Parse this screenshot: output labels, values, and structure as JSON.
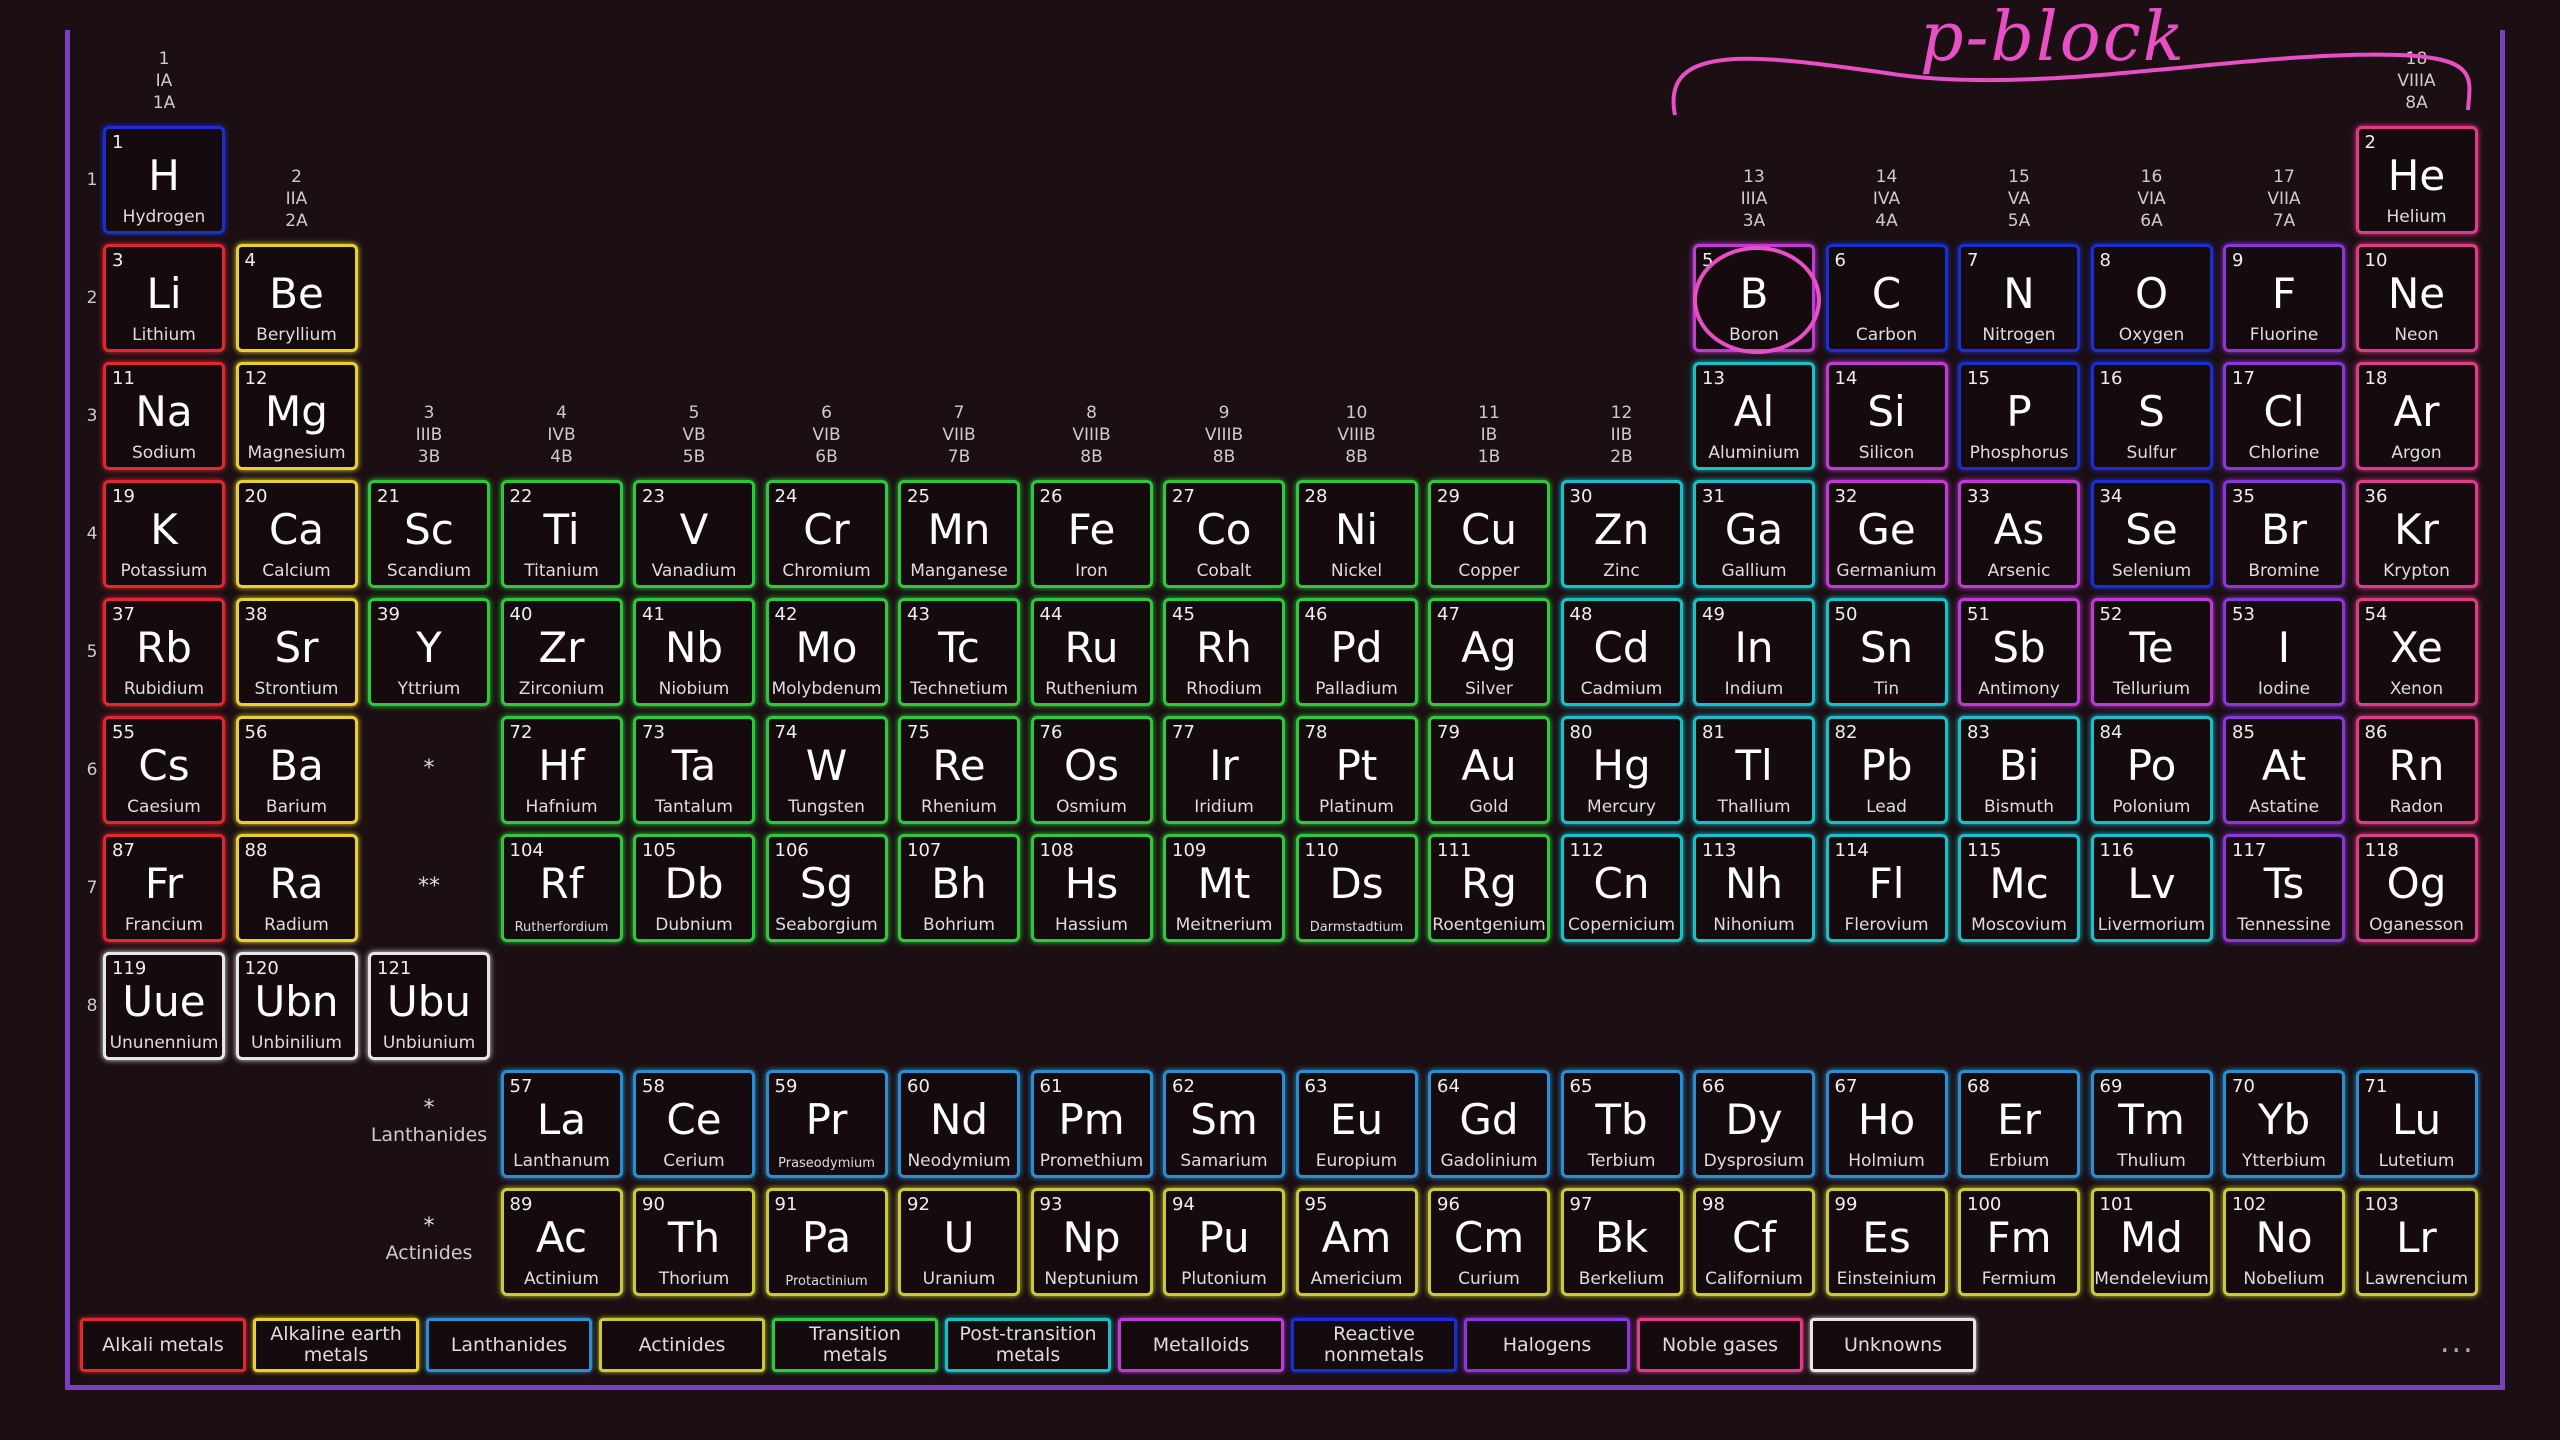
{
  "annotation": {
    "text": "p-block",
    "color": "#e94fc4"
  },
  "categories": {
    "alkali": "#e02830",
    "alkaline": "#e8d030",
    "lanthanide": "#2a8fd0",
    "actinide": "#c9c93a",
    "transition": "#2dc83c",
    "post": "#19c0c8",
    "metalloid": "#c03ad8",
    "nonmetal": "#1c2ecf",
    "halogen": "#8a36d8",
    "noble": "#e03a8a",
    "unknown": "#e6e6e6"
  },
  "elements": [
    [
      "1",
      "H",
      "Hydrogen",
      "nonmetal"
    ],
    [
      "2",
      "He",
      "Helium",
      "noble"
    ],
    [
      "3",
      "Li",
      "Lithium",
      "alkali"
    ],
    [
      "4",
      "Be",
      "Beryllium",
      "alkaline"
    ],
    [
      "5",
      "B",
      "Boron",
      "metalloid"
    ],
    [
      "6",
      "C",
      "Carbon",
      "nonmetal"
    ],
    [
      "7",
      "N",
      "Nitrogen",
      "nonmetal"
    ],
    [
      "8",
      "O",
      "Oxygen",
      "nonmetal"
    ],
    [
      "9",
      "F",
      "Fluorine",
      "halogen"
    ],
    [
      "10",
      "Ne",
      "Neon",
      "noble"
    ],
    [
      "11",
      "Na",
      "Sodium",
      "alkali"
    ],
    [
      "12",
      "Mg",
      "Magnesium",
      "alkaline"
    ],
    [
      "13",
      "Al",
      "Aluminium",
      "post"
    ],
    [
      "14",
      "Si",
      "Silicon",
      "metalloid"
    ],
    [
      "15",
      "P",
      "Phosphorus",
      "nonmetal"
    ],
    [
      "16",
      "S",
      "Sulfur",
      "nonmetal"
    ],
    [
      "17",
      "Cl",
      "Chlorine",
      "halogen"
    ],
    [
      "18",
      "Ar",
      "Argon",
      "noble"
    ],
    [
      "19",
      "K",
      "Potassium",
      "alkali"
    ],
    [
      "20",
      "Ca",
      "Calcium",
      "alkaline"
    ],
    [
      "21",
      "Sc",
      "Scandium",
      "transition"
    ],
    [
      "22",
      "Ti",
      "Titanium",
      "transition"
    ],
    [
      "23",
      "V",
      "Vanadium",
      "transition"
    ],
    [
      "24",
      "Cr",
      "Chromium",
      "transition"
    ],
    [
      "25",
      "Mn",
      "Manganese",
      "transition"
    ],
    [
      "26",
      "Fe",
      "Iron",
      "transition"
    ],
    [
      "27",
      "Co",
      "Cobalt",
      "transition"
    ],
    [
      "28",
      "Ni",
      "Nickel",
      "transition"
    ],
    [
      "29",
      "Cu",
      "Copper",
      "transition"
    ],
    [
      "30",
      "Zn",
      "Zinc",
      "post"
    ],
    [
      "31",
      "Ga",
      "Gallium",
      "post"
    ],
    [
      "32",
      "Ge",
      "Germanium",
      "metalloid"
    ],
    [
      "33",
      "As",
      "Arsenic",
      "metalloid"
    ],
    [
      "34",
      "Se",
      "Selenium",
      "nonmetal"
    ],
    [
      "35",
      "Br",
      "Bromine",
      "halogen"
    ],
    [
      "36",
      "Kr",
      "Krypton",
      "noble"
    ],
    [
      "37",
      "Rb",
      "Rubidium",
      "alkali"
    ],
    [
      "38",
      "Sr",
      "Strontium",
      "alkaline"
    ],
    [
      "39",
      "Y",
      "Yttrium",
      "transition"
    ],
    [
      "40",
      "Zr",
      "Zirconium",
      "transition"
    ],
    [
      "41",
      "Nb",
      "Niobium",
      "transition"
    ],
    [
      "42",
      "Mo",
      "Molybdenum",
      "transition"
    ],
    [
      "43",
      "Tc",
      "Technetium",
      "transition"
    ],
    [
      "44",
      "Ru",
      "Ruthenium",
      "transition"
    ],
    [
      "45",
      "Rh",
      "Rhodium",
      "transition"
    ],
    [
      "46",
      "Pd",
      "Palladium",
      "transition"
    ],
    [
      "47",
      "Ag",
      "Silver",
      "transition"
    ],
    [
      "48",
      "Cd",
      "Cadmium",
      "post"
    ],
    [
      "49",
      "In",
      "Indium",
      "post"
    ],
    [
      "50",
      "Sn",
      "Tin",
      "post"
    ],
    [
      "51",
      "Sb",
      "Antimony",
      "metalloid"
    ],
    [
      "52",
      "Te",
      "Tellurium",
      "metalloid"
    ],
    [
      "53",
      "I",
      "Iodine",
      "halogen"
    ],
    [
      "54",
      "Xe",
      "Xenon",
      "noble"
    ],
    [
      "55",
      "Cs",
      "Caesium",
      "alkali"
    ],
    [
      "56",
      "Ba",
      "Barium",
      "alkaline"
    ],
    [
      "72",
      "Hf",
      "Hafnium",
      "transition"
    ],
    [
      "73",
      "Ta",
      "Tantalum",
      "transition"
    ],
    [
      "74",
      "W",
      "Tungsten",
      "transition"
    ],
    [
      "75",
      "Re",
      "Rhenium",
      "transition"
    ],
    [
      "76",
      "Os",
      "Osmium",
      "transition"
    ],
    [
      "77",
      "Ir",
      "Iridium",
      "transition"
    ],
    [
      "78",
      "Pt",
      "Platinum",
      "transition"
    ],
    [
      "79",
      "Au",
      "Gold",
      "transition"
    ],
    [
      "80",
      "Hg",
      "Mercury",
      "post"
    ],
    [
      "81",
      "Tl",
      "Thallium",
      "post"
    ],
    [
      "82",
      "Pb",
      "Lead",
      "post"
    ],
    [
      "83",
      "Bi",
      "Bismuth",
      "post"
    ],
    [
      "84",
      "Po",
      "Polonium",
      "post"
    ],
    [
      "85",
      "At",
      "Astatine",
      "halogen"
    ],
    [
      "86",
      "Rn",
      "Radon",
      "noble"
    ],
    [
      "87",
      "Fr",
      "Francium",
      "alkali"
    ],
    [
      "88",
      "Ra",
      "Radium",
      "alkaline"
    ],
    [
      "104",
      "Rf",
      "Rutherfordium",
      "transition"
    ],
    [
      "105",
      "Db",
      "Dubnium",
      "transition"
    ],
    [
      "106",
      "Sg",
      "Seaborgium",
      "transition"
    ],
    [
      "107",
      "Bh",
      "Bohrium",
      "transition"
    ],
    [
      "108",
      "Hs",
      "Hassium",
      "transition"
    ],
    [
      "109",
      "Mt",
      "Meitnerium",
      "transition"
    ],
    [
      "110",
      "Ds",
      "Darmstadtium",
      "transition"
    ],
    [
      "111",
      "Rg",
      "Roentgenium",
      "transition"
    ],
    [
      "112",
      "Cn",
      "Copernicium",
      "post"
    ],
    [
      "113",
      "Nh",
      "Nihonium",
      "post"
    ],
    [
      "114",
      "Fl",
      "Flerovium",
      "post"
    ],
    [
      "115",
      "Mc",
      "Moscovium",
      "post"
    ],
    [
      "116",
      "Lv",
      "Livermorium",
      "post"
    ],
    [
      "117",
      "Ts",
      "Tennessine",
      "halogen"
    ],
    [
      "118",
      "Og",
      "Oganesson",
      "noble"
    ],
    [
      "119",
      "Uue",
      "Ununennium",
      "unknown"
    ],
    [
      "120",
      "Ubn",
      "Unbinilium",
      "unknown"
    ],
    [
      "121",
      "Ubu",
      "Unbiunium",
      "unknown"
    ],
    [
      "57",
      "La",
      "Lanthanum",
      "lanthanide"
    ],
    [
      "58",
      "Ce",
      "Cerium",
      "lanthanide"
    ],
    [
      "59",
      "Pr",
      "Praseodymium",
      "lanthanide"
    ],
    [
      "60",
      "Nd",
      "Neodymium",
      "lanthanide"
    ],
    [
      "61",
      "Pm",
      "Promethium",
      "lanthanide"
    ],
    [
      "62",
      "Sm",
      "Samarium",
      "lanthanide"
    ],
    [
      "63",
      "Eu",
      "Europium",
      "lanthanide"
    ],
    [
      "64",
      "Gd",
      "Gadolinium",
      "lanthanide"
    ],
    [
      "65",
      "Tb",
      "Terbium",
      "lanthanide"
    ],
    [
      "66",
      "Dy",
      "Dysprosium",
      "lanthanide"
    ],
    [
      "67",
      "Ho",
      "Holmium",
      "lanthanide"
    ],
    [
      "68",
      "Er",
      "Erbium",
      "lanthanide"
    ],
    [
      "69",
      "Tm",
      "Thulium",
      "lanthanide"
    ],
    [
      "70",
      "Yb",
      "Ytterbium",
      "lanthanide"
    ],
    [
      "71",
      "Lu",
      "Lutetium",
      "lanthanide"
    ],
    [
      "89",
      "Ac",
      "Actinium",
      "actinide"
    ],
    [
      "90",
      "Th",
      "Thorium",
      "actinide"
    ],
    [
      "91",
      "Pa",
      "Protactinium",
      "actinide"
    ],
    [
      "92",
      "U",
      "Uranium",
      "actinide"
    ],
    [
      "93",
      "Np",
      "Neptunium",
      "actinide"
    ],
    [
      "94",
      "Pu",
      "Plutonium",
      "actinide"
    ],
    [
      "95",
      "Am",
      "Americium",
      "actinide"
    ],
    [
      "96",
      "Cm",
      "Curium",
      "actinide"
    ],
    [
      "97",
      "Bk",
      "Berkelium",
      "actinide"
    ],
    [
      "98",
      "Cf",
      "Californium",
      "actinide"
    ],
    [
      "99",
      "Es",
      "Einsteinium",
      "actinide"
    ],
    [
      "100",
      "Fm",
      "Fermium",
      "actinide"
    ],
    [
      "101",
      "Md",
      "Mendelevium",
      "actinide"
    ],
    [
      "102",
      "No",
      "Nobelium",
      "actinide"
    ],
    [
      "103",
      "Lr",
      "Lawrencium",
      "actinide"
    ]
  ],
  "group_labels": [
    [
      "1",
      "IA",
      "1A"
    ],
    [
      "2",
      "IIA",
      "2A"
    ],
    [
      "3",
      "IIIB",
      "3B"
    ],
    [
      "4",
      "IVB",
      "4B"
    ],
    [
      "5",
      "VB",
      "5B"
    ],
    [
      "6",
      "VIB",
      "6B"
    ],
    [
      "7",
      "VIIB",
      "7B"
    ],
    [
      "8",
      "VIIIB",
      "8B"
    ],
    [
      "9",
      "VIIIB",
      "8B"
    ],
    [
      "10",
      "VIIIB",
      "8B"
    ],
    [
      "11",
      "IB",
      "1B"
    ],
    [
      "12",
      "IIB",
      "2B"
    ],
    [
      "13",
      "IIIA",
      "3A"
    ],
    [
      "14",
      "IVA",
      "4A"
    ],
    [
      "15",
      "VA",
      "5A"
    ],
    [
      "16",
      "VIA",
      "6A"
    ],
    [
      "17",
      "VIIA",
      "7A"
    ],
    [
      "18",
      "VIIIA",
      "8A"
    ]
  ],
  "period_labels": [
    "1",
    "2",
    "3",
    "4",
    "5",
    "6",
    "7",
    "8"
  ],
  "markers": {
    "period6": "*",
    "period7": "**",
    "lanthanides_marker": "*",
    "actinides_marker": "*"
  },
  "row_labels": {
    "lanthanides": "Lanthanides",
    "actinides": "Actinides"
  },
  "legend": [
    [
      "Alkali metals",
      "alkali"
    ],
    [
      "Alkaline earth metals",
      "alkaline"
    ],
    [
      "Lanthanides",
      "lanthanide"
    ],
    [
      "Actinides",
      "actinide"
    ],
    [
      "Transition metals",
      "transition"
    ],
    [
      "Post-transition metals",
      "post"
    ],
    [
      "Metalloids",
      "metalloid"
    ],
    [
      "Reactive nonmetals",
      "nonmetal"
    ],
    [
      "Halogens",
      "halogen"
    ],
    [
      "Noble gases",
      "noble"
    ],
    [
      "Unknowns",
      "unknown"
    ]
  ],
  "more_label": "..."
}
